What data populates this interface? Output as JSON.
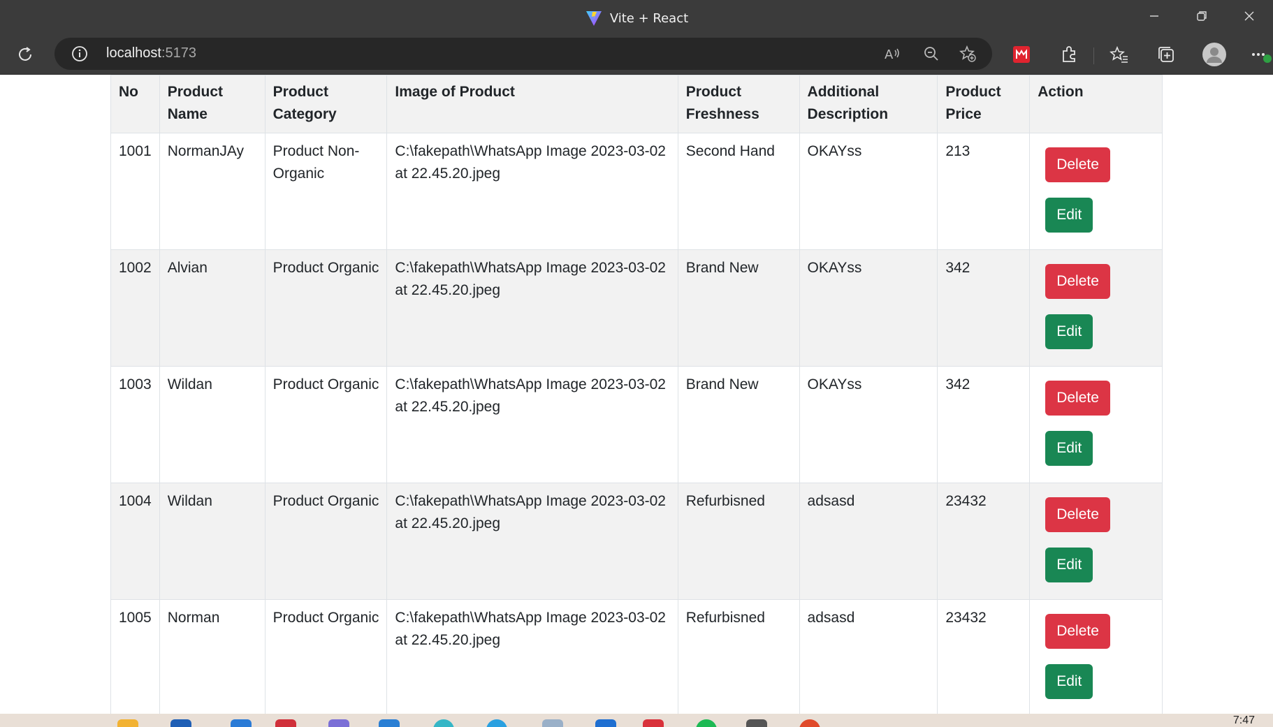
{
  "browser": {
    "tab_title": "Vite + React",
    "url_host": "localhost",
    "url_port": ":5173"
  },
  "table": {
    "headers": [
      "No",
      "Product Name",
      "Product Category",
      "Image of Product",
      "Product Freshness",
      "Additional Description",
      "Product Price",
      "Action"
    ],
    "rows": [
      {
        "no": "1001",
        "name": "NormanJAy",
        "category": "Product Non-Organic",
        "image": "C:\\fakepath\\WhatsApp Image 2023-03-02 at 22.45.20.jpeg",
        "freshness": "Second Hand",
        "description": "OKAYss",
        "price": "213"
      },
      {
        "no": "1002",
        "name": "Alvian",
        "category": "Product Organic",
        "image": "C:\\fakepath\\WhatsApp Image 2023-03-02 at 22.45.20.jpeg",
        "freshness": "Brand New",
        "description": "OKAYss",
        "price": "342"
      },
      {
        "no": "1003",
        "name": "Wildan",
        "category": "Product Organic",
        "image": "C:\\fakepath\\WhatsApp Image 2023-03-02 at 22.45.20.jpeg",
        "freshness": "Brand New",
        "description": "OKAYss",
        "price": "342"
      },
      {
        "no": "1004",
        "name": "Wildan",
        "category": "Product Organic",
        "image": "C:\\fakepath\\WhatsApp Image 2023-03-02 at 22.45.20.jpeg",
        "freshness": "Refurbisned",
        "description": "adsasd",
        "price": "23432"
      },
      {
        "no": "1005",
        "name": "Norman",
        "category": "Product Organic",
        "image": "C:\\fakepath\\WhatsApp Image 2023-03-02 at 22.45.20.jpeg",
        "freshness": "Refurbisned",
        "description": "adsasd",
        "price": "23432"
      }
    ],
    "delete_label": "Delete",
    "edit_label": "Edit"
  },
  "taskbar": {
    "clock": "7:47"
  },
  "colors": {
    "delete": "#dc3545",
    "edit": "#198754",
    "chrome": "#3b3b3b"
  }
}
